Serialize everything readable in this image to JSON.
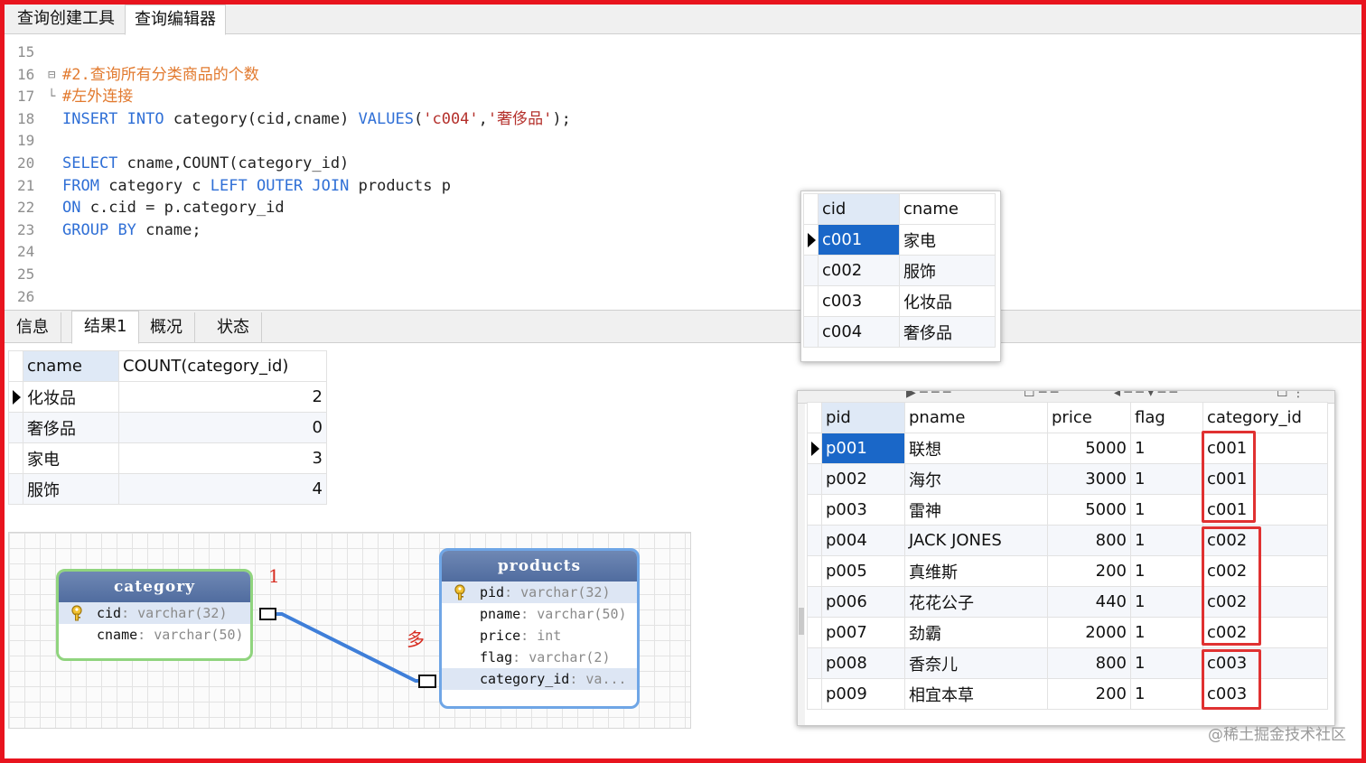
{
  "top_tabs": [
    "查询创建工具",
    "查询编辑器"
  ],
  "editor": {
    "lines": [
      {
        "no": "15",
        "fold": "",
        "tokens": []
      },
      {
        "no": "16",
        "fold": "⊟",
        "tokens": [
          {
            "t": "#2.查询所有分类商品的个数",
            "c": "cmt"
          }
        ]
      },
      {
        "no": "17",
        "fold": "└",
        "tokens": [
          {
            "t": "#左外连接",
            "c": "cmt"
          }
        ]
      },
      {
        "no": "18",
        "fold": "",
        "tokens": [
          {
            "t": "INSERT",
            "c": "kw"
          },
          {
            "t": " ",
            "c": "id"
          },
          {
            "t": "INTO",
            "c": "kw"
          },
          {
            "t": " category(cid,cname) ",
            "c": "id"
          },
          {
            "t": "VALUES",
            "c": "kw"
          },
          {
            "t": "(",
            "c": "id"
          },
          {
            "t": "'c004'",
            "c": "str"
          },
          {
            "t": ",",
            "c": "id"
          },
          {
            "t": "'奢侈品'",
            "c": "str"
          },
          {
            "t": ");",
            "c": "id"
          }
        ]
      },
      {
        "no": "19",
        "fold": "",
        "tokens": []
      },
      {
        "no": "20",
        "fold": "",
        "tokens": [
          {
            "t": "SELECT",
            "c": "kw"
          },
          {
            "t": " cname,COUNT(category_id)",
            "c": "id"
          }
        ]
      },
      {
        "no": "21",
        "fold": "",
        "tokens": [
          {
            "t": "FROM",
            "c": "kw"
          },
          {
            "t": " category c ",
            "c": "id"
          },
          {
            "t": "LEFT",
            "c": "kw"
          },
          {
            "t": " ",
            "c": "id"
          },
          {
            "t": "OUTER",
            "c": "kw"
          },
          {
            "t": " ",
            "c": "id"
          },
          {
            "t": "JOIN",
            "c": "kw"
          },
          {
            "t": " products p",
            "c": "id"
          }
        ]
      },
      {
        "no": "22",
        "fold": "",
        "tokens": [
          {
            "t": "ON",
            "c": "kw"
          },
          {
            "t": " c.cid = p.category_id",
            "c": "id"
          }
        ]
      },
      {
        "no": "23",
        "fold": "",
        "tokens": [
          {
            "t": "GROUP",
            "c": "kw"
          },
          {
            "t": " ",
            "c": "id"
          },
          {
            "t": "BY",
            "c": "kw"
          },
          {
            "t": " cname;",
            "c": "id"
          }
        ]
      },
      {
        "no": "24",
        "fold": "",
        "tokens": []
      },
      {
        "no": "25",
        "fold": "",
        "tokens": []
      },
      {
        "no": "26",
        "fold": "",
        "tokens": []
      }
    ]
  },
  "result_tabs": [
    "信息",
    "结果1",
    "概况",
    "状态"
  ],
  "result_grid": {
    "headers": [
      "cname",
      "COUNT(category_id)"
    ],
    "rows": [
      [
        "化妆品",
        "2"
      ],
      [
        "奢侈品",
        "0"
      ],
      [
        "家电",
        "3"
      ],
      [
        "服饰",
        "4"
      ]
    ]
  },
  "category_table": {
    "headers": [
      "cid",
      "cname"
    ],
    "rows": [
      [
        "c001",
        "家电"
      ],
      [
        "c002",
        "服饰"
      ],
      [
        "c003",
        "化妆品"
      ],
      [
        "c004",
        "奢侈品"
      ]
    ]
  },
  "products_table": {
    "headers": [
      "pid",
      "pname",
      "price",
      "flag",
      "category_id"
    ],
    "rows": [
      [
        "p001",
        "联想",
        "5000",
        "1",
        "c001"
      ],
      [
        "p002",
        "海尔",
        "3000",
        "1",
        "c001"
      ],
      [
        "p003",
        "雷神",
        "5000",
        "1",
        "c001"
      ],
      [
        "p004",
        "JACK JONES",
        "800",
        "1",
        "c002"
      ],
      [
        "p005",
        "真维斯",
        "200",
        "1",
        "c002"
      ],
      [
        "p006",
        "花花公子",
        "440",
        "1",
        "c002"
      ],
      [
        "p007",
        "劲霸",
        "2000",
        "1",
        "c002"
      ],
      [
        "p008",
        "香奈儿",
        "800",
        "1",
        "c003"
      ],
      [
        "p009",
        "相宜本草",
        "200",
        "1",
        "c003"
      ]
    ]
  },
  "er_diagram": {
    "category": {
      "title": "category",
      "fields": [
        {
          "name": "cid",
          "type": "varchar(32)",
          "pk": true
        },
        {
          "name": "cname",
          "type": "varchar(50)",
          "pk": false
        }
      ]
    },
    "products": {
      "title": "products",
      "fields": [
        {
          "name": "pid",
          "type": "varchar(32)",
          "pk": true
        },
        {
          "name": "pname",
          "type": "varchar(50)",
          "pk": false
        },
        {
          "name": "price",
          "type": "int",
          "pk": false
        },
        {
          "name": "flag",
          "type": "varchar(2)",
          "pk": false
        },
        {
          "name": "category_id",
          "type": "va...",
          "pk": false
        }
      ]
    },
    "one_label": "1",
    "many_label": "多"
  },
  "watermark": "@稀土掘金技术社区",
  "colors": {
    "frame": "#e8141e",
    "keyword": "#2f6fd6",
    "string": "#b4302b",
    "comment": "#e27a2f",
    "selection": "#1a67c8",
    "annotation": "#e03131"
  }
}
